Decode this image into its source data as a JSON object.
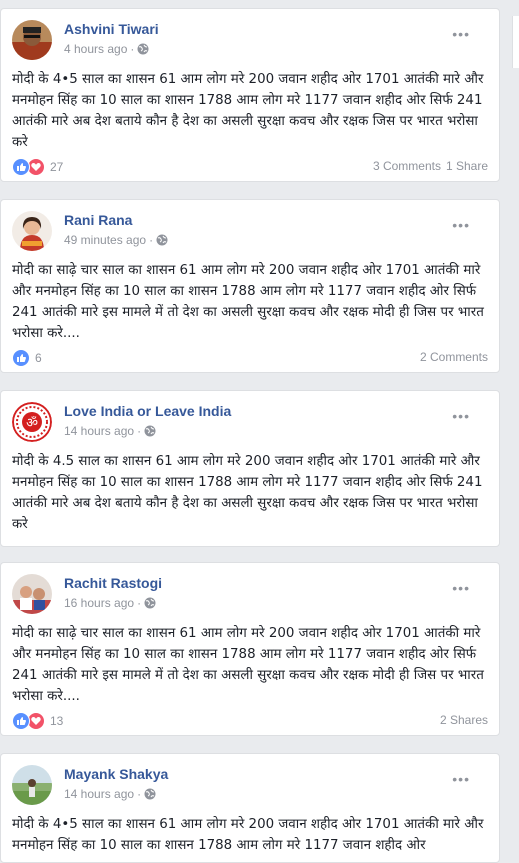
{
  "posts": [
    {
      "author": "Ashvini Tiwari",
      "time": "4 hours ago",
      "avatar": "avatar-person",
      "text": "मोदी के 4•5 साल का शासन 61 आम लोग मरे 200 जवान शहीद ओर 1701 आतंकी मारे और मनमोहन सिंह का 10 साल का शासन 1788 आम लोग मरे 1177 जवान शहीद ओर सिर्फ 241 आतंकी मारे अब देश बताये कौन है देश का असली सुरक्षा कवच और रक्षक जिस पर भारत भरोसा करे",
      "reactions": [
        "like",
        "love"
      ],
      "reaction_count": "27",
      "comments": "3 Comments",
      "shares": "1 Share"
    },
    {
      "author": "Rani Rana",
      "time": "49 minutes ago",
      "avatar": "avatar-woman",
      "text": "मोदी का साढ़े चार साल का शासन 61 आम लोग मरे 200 जवान शहीद ओर 1701 आतंकी मारे और मनमोहन सिंह का 10 साल का शासन 1788 आम लोग मरे 1177 जवान शहीद ओर सिर्फ 241 आतंकी मारे इस मामले में तो देश का असली सुरक्षा कवच और रक्षक मोदी ही जिस पर भारत भरोसा करे....",
      "reactions": [
        "like"
      ],
      "reaction_count": "6",
      "comments": "2 Comments",
      "shares": ""
    },
    {
      "author": "Love India or Leave India",
      "time": "14 hours ago",
      "avatar": "om-logo",
      "text": "मोदी के 4.5 साल का शासन 61 आम लोग मरे 200 जवान शहीद ओर 1701 आतंकी मारे और मनमोहन सिंह का 10 साल का शासन 1788 आम लोग मरे 1177 जवान शहीद ओर सिर्फ 241 आतंकी मारे अब देश बताये कौन है देश का असली सुरक्षा कवच और रक्षक जिस पर भारत भरोसा करे",
      "reactions": [],
      "reaction_count": "",
      "comments": "",
      "shares": ""
    },
    {
      "author": "Rachit Rastogi",
      "time": "16 hours ago",
      "avatar": "avatar-group",
      "text": "मोदी का साढ़े चार साल का शासन 61 आम लोग मरे 200 जवान शहीद ओर 1701 आतंकी मारे और मनमोहन सिंह का 10 साल का शासन 1788 आम लोग मरे 1177 जवान शहीद ओर सिर्फ 241 आतंकी मारे इस मामले में तो देश का असली सुरक्षा कवच और रक्षक मोदी ही जिस पर भारत भरोसा करे....",
      "reactions": [
        "like",
        "love"
      ],
      "reaction_count": "13",
      "comments": "",
      "shares": "2 Shares"
    },
    {
      "author": "Mayank Shakya",
      "time": "14 hours ago",
      "avatar": "avatar-field",
      "text": "मोदी के 4•5 साल का शासन 61 आम लोग मरे 200 जवान शहीद ओर 1701 आतंकी मारे और मनमोहन सिंह का 10 साल का शासन 1788 आम लोग मरे 1177 जवान शहीद ओर",
      "reactions": [],
      "reaction_count": "",
      "comments": "",
      "shares": ""
    }
  ],
  "colors": {
    "background": "#e9ebee",
    "name": "#365899",
    "meta": "#90949c",
    "like": "#5890ff",
    "love": "#f25268"
  }
}
